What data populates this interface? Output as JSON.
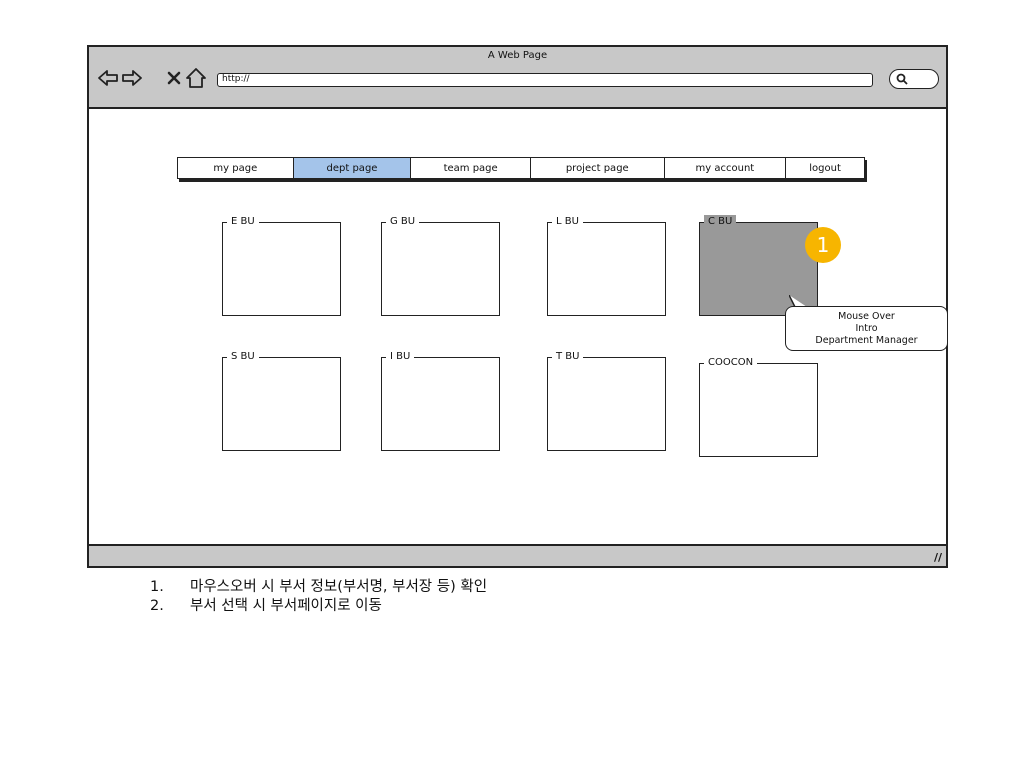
{
  "browser": {
    "title": "A Web Page",
    "url": "http://"
  },
  "nav": {
    "tabs": [
      {
        "label": "my page"
      },
      {
        "label": "dept page"
      },
      {
        "label": "team page"
      },
      {
        "label": "project page"
      },
      {
        "label": "my account"
      },
      {
        "label": "logout"
      }
    ],
    "active": "dept page"
  },
  "departments": [
    {
      "label": "E BU"
    },
    {
      "label": "G BU"
    },
    {
      "label": "L BU"
    },
    {
      "label": "C BU"
    },
    {
      "label": "S BU"
    },
    {
      "label": "I BU"
    },
    {
      "label": "T BU"
    },
    {
      "label": "COOCON"
    }
  ],
  "annotation": {
    "badge": "1",
    "callout_lines": [
      "Mouse Over",
      "Intro",
      "Department Manager"
    ],
    "badge_color": "#f7b500"
  },
  "notes": [
    {
      "num": "1.",
      "text": "마우스오버 시 부서 정보(부서명, 부서장 등) 확인"
    },
    {
      "num": "2.",
      "text": "부서 선택 시 부서페이지로 이동"
    }
  ],
  "colors": {
    "active_tab": "#a4c4ea",
    "hover_panel": "#999999",
    "chrome": "#c8c8c8"
  }
}
